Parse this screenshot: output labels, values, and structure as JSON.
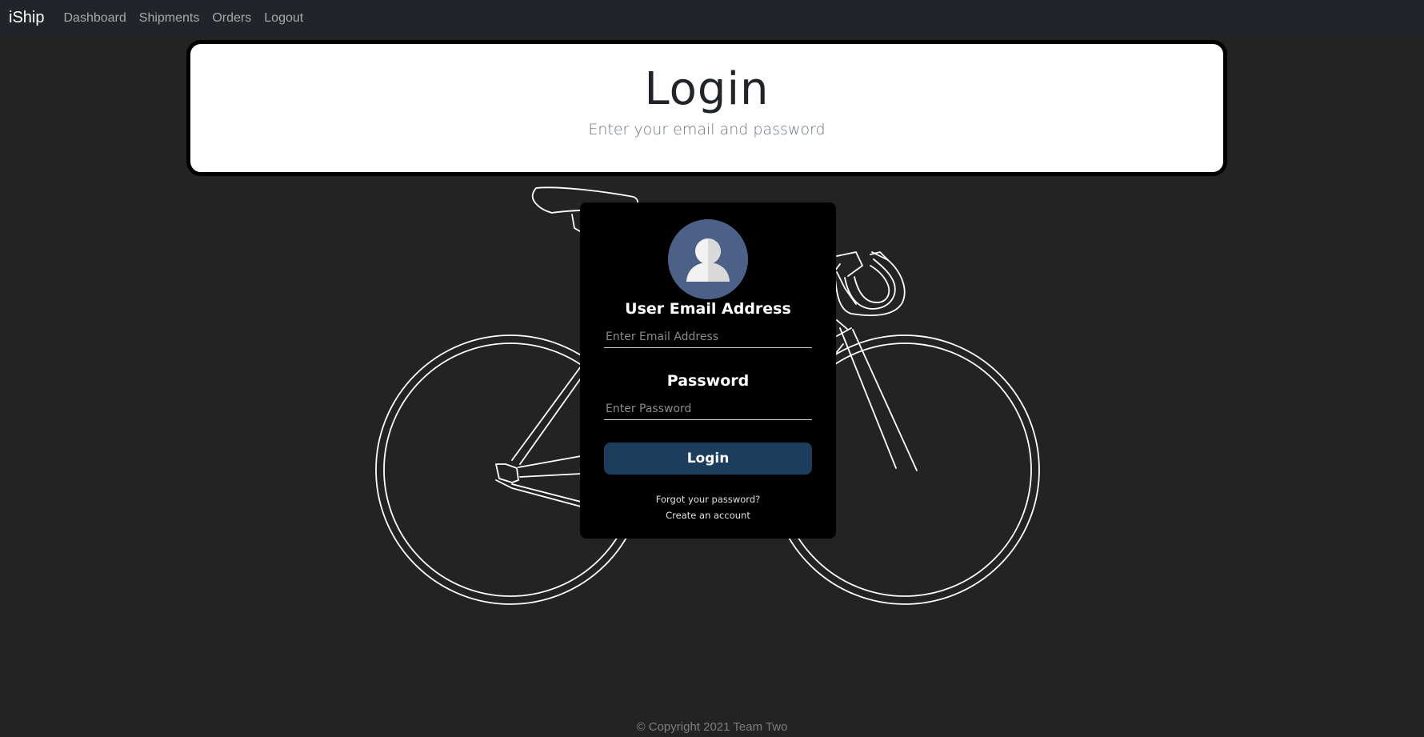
{
  "navbar": {
    "brand": "iShip",
    "links": [
      "Dashboard",
      "Shipments",
      "Orders",
      "Logout"
    ]
  },
  "header": {
    "title": "Login",
    "subtitle": "Enter your email and password"
  },
  "login_form": {
    "avatar_icon": "user-avatar-icon",
    "email_label": "User Email Address",
    "email_placeholder": "Enter Email Address",
    "email_value": "",
    "password_label": "Password",
    "password_placeholder": "Enter Password",
    "password_value": "",
    "submit_label": "Login",
    "forgot_password": "Forgot your password?",
    "create_account": "Create an account"
  },
  "background": {
    "illustration": "bicycle-outline-icon"
  },
  "footer": {
    "copyright": "© Copyright 2021 Team Two"
  },
  "colors": {
    "page_background": "#232323",
    "navbar": "#212429",
    "card": "#000000",
    "button": "#1d3d5c",
    "avatar": "#4d6088"
  }
}
